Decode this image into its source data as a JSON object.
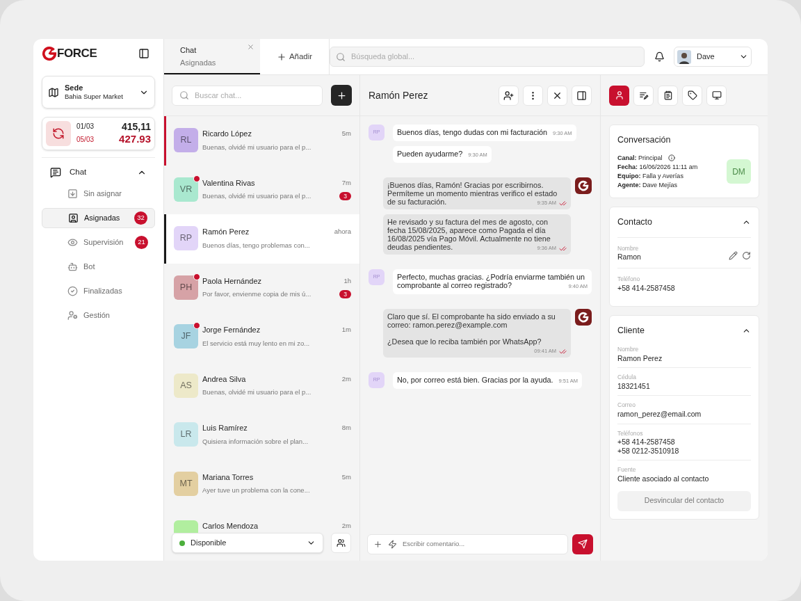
{
  "sidebar": {
    "brand": "FORCE",
    "branch": {
      "label": "Sede",
      "value": "Bahia Super Market"
    },
    "rates": {
      "date_previous": "01/03",
      "value_previous": "415,11",
      "date_current": "05/03",
      "value_current": "427.93"
    },
    "nav": [
      {
        "label": "Chat",
        "expanded": true,
        "children": [
          {
            "label": "Sin asignar",
            "kind": "unassigned",
            "selected": false
          },
          {
            "label": "Asignadas",
            "kind": "assigned",
            "selected": true,
            "badge": "32"
          },
          {
            "label": "Supervisión",
            "kind": "supervision",
            "selected": false,
            "badge": "21"
          },
          {
            "label": "Bot",
            "kind": "bot",
            "selected": false
          },
          {
            "label": "Finalizadas",
            "kind": "finished",
            "selected": false
          },
          {
            "label": "Gestión",
            "kind": "management",
            "selected": false
          }
        ]
      }
    ]
  },
  "tabs": [
    {
      "title": "Chat",
      "subtitle": "Asignadas",
      "selected": true
    }
  ],
  "add_tab": "Añadir",
  "global_search": {
    "placeholder": "Búsqueda global..."
  },
  "user": {
    "name": "Dave"
  },
  "chat_list": {
    "search": {
      "placeholder": "Buscar chat..."
    },
    "conversations": [
      {
        "initials": "RL",
        "name": "Ricardo López",
        "time": "5m",
        "preview": "Buenas, olvidé mi usuario para el p...",
        "color": "#c3aee9",
        "unread": false,
        "urgent": true,
        "selected": false
      },
      {
        "initials": "VR",
        "name": "Valentina Rivas",
        "time": "7m",
        "preview": "Buenas, olvidé mi usuario para el p...",
        "color": "#a9e8cf",
        "unread": true,
        "badge": "3",
        "urgent": false,
        "selected": false
      },
      {
        "initials": "RP",
        "name": "Ramón Perez",
        "time": "ahora",
        "preview": "Buenos días, tengo problemas con...",
        "color": "#e2d5f8",
        "unread": false,
        "urgent": false,
        "selected": true
      },
      {
        "initials": "PH",
        "name": "Paola Hernández",
        "time": "1h",
        "preview": "Por favor, envienme copia de mis ú...",
        "color": "#d6a2a6",
        "unread": true,
        "badge": "3",
        "urgent": false,
        "selected": false
      },
      {
        "initials": "JF",
        "name": "Jorge Fernández",
        "time": "1m",
        "preview": "El servicio está muy lento en mi zo...",
        "color": "#a7d3e1",
        "unread": true,
        "urgent": false,
        "selected": false
      },
      {
        "initials": "AS",
        "name": "Andrea Silva",
        "time": "2m",
        "preview": "Buenas, olvidé mi usuario para el p...",
        "color": "#ede9c9",
        "unread": false,
        "urgent": false,
        "selected": false
      },
      {
        "initials": "LR",
        "name": "Luis Ramírez",
        "time": "8m",
        "preview": "Quisiera información sobre el plan...",
        "color": "#c9e8ec",
        "unread": false,
        "urgent": false,
        "selected": false
      },
      {
        "initials": "MT",
        "name": "Mariana Torres",
        "time": "5m",
        "preview": "Ayer tuve un problema con la cone...",
        "color": "#e3cfa1",
        "unread": false,
        "urgent": false,
        "selected": false
      },
      {
        "name": "Carlos Mendoza",
        "time": "2m",
        "color": "#b1ee9f",
        "unread": false,
        "urgent": false,
        "selected": false
      }
    ],
    "status": {
      "label": "Disponible",
      "color": "#4caf3c"
    }
  },
  "conversation": {
    "title": "Ramón Perez",
    "messages": [
      {
        "kind": "customer",
        "initials": "RP",
        "text": "Buenos días, tengo dudas con mi facturación",
        "time": "9:30 AM"
      },
      {
        "kind": "customer",
        "text": "Pueden ayudarme?",
        "time": "9:30 AM"
      },
      {
        "kind": "agent",
        "text": "¡Buenos días, Ramón! Gracias por escribirnos. Permíteme un momento mientras verifico el estado de su facturación.",
        "time": "9:35 AM",
        "read": true
      },
      {
        "kind": "agent",
        "text": "He revisado y su factura del mes de agosto, con fecha 15/08/2025, aparece como Pagada el día 16/08/2025 vía Pago Móvil. Actualmente no tiene deudas pendientes.",
        "time": "9:36 AM",
        "read": true
      },
      {
        "kind": "customer",
        "initials": "RP",
        "text": "Perfecto, muchas gracias. ¿Podría enviarme también un comprobante al correo registrado?",
        "time": "9:40 AM"
      },
      {
        "kind": "agent",
        "text": "Claro que sí. El comprobante ha sido enviado a su correo: ramon.perez@example.com\n\n¿Desea que lo reciba también por WhatsApp?",
        "time": "09:41 AM",
        "read": true
      },
      {
        "kind": "customer",
        "initials": "RP",
        "text": "No, por correo está bien. Gracias por la ayuda.",
        "time": "9:51 AM"
      }
    ],
    "composer": {
      "placeholder": "Escribir comentario..."
    }
  },
  "details": {
    "tabs": [
      {
        "kind": "contact",
        "selected": true
      },
      {
        "kind": "notes",
        "selected": false
      },
      {
        "kind": "receipt",
        "selected": false
      },
      {
        "kind": "tags",
        "selected": false
      },
      {
        "kind": "screen",
        "selected": false
      }
    ],
    "summary": {
      "title": "Conversación",
      "fields": [
        {
          "label": "Canal:",
          "value": "Principal",
          "info": true
        },
        {
          "label": "Fecha:",
          "value": "16/06/2026 11:11 am"
        },
        {
          "label": "Equipo:",
          "value": "Falla y Averías"
        },
        {
          "label": "Agente:",
          "value": "Dave Mejías"
        }
      ],
      "agent_initials": "DM"
    },
    "contact": {
      "title": "Contacto",
      "expanded": true,
      "fields": [
        {
          "label": "Nombre",
          "values": [
            "Ramon"
          ],
          "editable": true
        },
        {
          "label": "Teléfono",
          "values": [
            "+58 414-2587458"
          ]
        }
      ]
    },
    "client": {
      "title": "Cliente",
      "expanded": true,
      "fields": [
        {
          "label": "Nombre",
          "values": [
            "Ramon Perez"
          ]
        },
        {
          "label": "Cédula",
          "values": [
            "18321451"
          ]
        },
        {
          "label": "Correo",
          "values": [
            "ramon_perez@email.com"
          ]
        },
        {
          "label": "Teléfonos",
          "values": [
            "+58 414-2587458",
            "+58 0212-3510918"
          ]
        },
        {
          "label": "Fuente",
          "values": [
            "Cliente asociado al contacto"
          ]
        }
      ],
      "button": "Desvincular del contacto"
    }
  }
}
